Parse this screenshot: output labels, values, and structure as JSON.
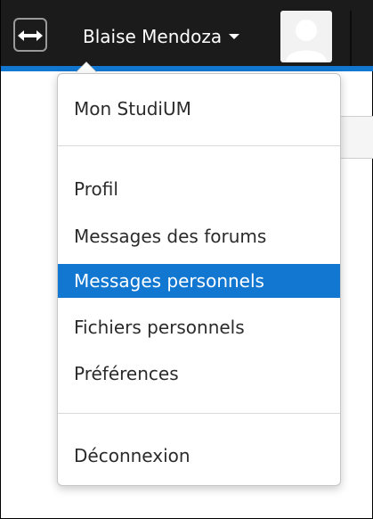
{
  "navbar": {
    "toggle_icon": "expand-arrows-icon",
    "user_name": "Blaise Mendoza",
    "avatar_icon": "user-avatar-icon",
    "background_color": "#1b1b1b",
    "accent_color": "#1177d1"
  },
  "dropdown": {
    "items": [
      {
        "label": "Mon StudiUM"
      },
      {
        "label": "Profil"
      },
      {
        "label": "Messages des forums"
      },
      {
        "label": "Messages personnels"
      },
      {
        "label": "Fichiers personnels"
      },
      {
        "label": "Préférences"
      },
      {
        "label": "Déconnexion"
      }
    ],
    "active_item": "Messages personnels"
  }
}
